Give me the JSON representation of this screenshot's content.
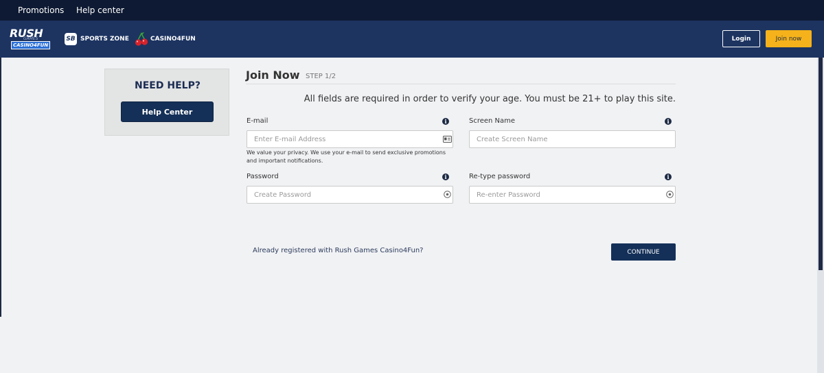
{
  "topnav": {
    "promotions": "Promotions",
    "help_center": "Help center"
  },
  "header": {
    "logo": {
      "line1": "RUSH",
      "line2": "GAMES",
      "line3": "CASINO4FUN"
    },
    "sports_zone": {
      "badge": "SB",
      "label": "SPORTS ZONE"
    },
    "casino4fun": {
      "label": "CASINO4FUN"
    },
    "login": "Login",
    "join_now": "Join now"
  },
  "help_card": {
    "title": "NEED HELP?",
    "button": "Help Center"
  },
  "form": {
    "title": "Join Now",
    "step": "STEP 1/2",
    "notice": "All fields are required in order to verify your age. You must be 21+ to play this site.",
    "email": {
      "label": "E-mail",
      "placeholder": "Enter E-mail Address",
      "value": "",
      "note": "We value your privacy. We use your e-mail to send exclusive promotions and important notifications."
    },
    "screen_name": {
      "label": "Screen Name",
      "placeholder": "Create Screen Name",
      "value": ""
    },
    "password": {
      "label": "Password",
      "placeholder": "Create Password",
      "value": ""
    },
    "retype_password": {
      "label": "Re-type password",
      "placeholder": "Re-enter Password",
      "value": ""
    },
    "already_registered": "Already registered with Rush Games Casino4Fun?",
    "continue": "CONTINUE"
  },
  "icons": {
    "info": "info-icon",
    "id_card": "id-card-icon",
    "eye": "eye-icon",
    "cherry": "cherry-icon"
  },
  "colors": {
    "topbar": "#0e1a33",
    "header": "#1d3461",
    "accent": "#f5b21a",
    "primary_button": "#143058",
    "page_bg": "#f1f2f4"
  }
}
